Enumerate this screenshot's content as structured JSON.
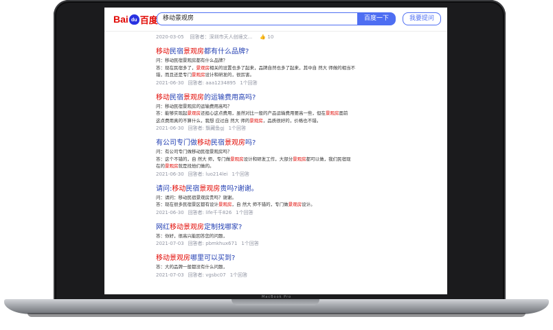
{
  "bezel_text": "MacBook Pro",
  "header": {
    "logo_parts": [
      "Bai",
      "du",
      "百度"
    ],
    "query": "移动景观房",
    "search_label": "百度一下",
    "ask_label": "我要提问"
  },
  "first_meta": {
    "date": "2020-03-05",
    "answerer": "回答者：深圳市天人创境文...",
    "likes": "10"
  },
  "results": [
    {
      "title": [
        [
          "移动",
          1
        ],
        [
          "民宿",
          0
        ],
        [
          "景观房",
          1
        ],
        [
          "都有什么品牌?",
          0
        ]
      ],
      "lines": [
        [
          [
            "问：移动民宿景观房都有什么品牌？",
            0
          ]
        ],
        [
          [
            "答：现在民宿多了，",
            0
          ],
          [
            "景观房",
            1
          ],
          [
            "相关的设置也多了起来，品牌自然也多了起来，其中自 然大 师做的相当不",
            0
          ]
        ],
        [
          [
            "错，而且还是专门",
            0
          ],
          [
            "景观房",
            1
          ],
          [
            "设计和研发的，很厉害。",
            0
          ]
        ]
      ],
      "date": "2021-06-30",
      "answerer": "回答者: aaa1234895",
      "count": "1个回答"
    },
    {
      "title": [
        [
          "移动",
          1
        ],
        [
          "民宿",
          0
        ],
        [
          "景观房",
          1
        ],
        [
          "的运输费用高吗?",
          0
        ]
      ],
      "lines": [
        [
          [
            "问：移动民宿景观房的运输费用高吗？",
            0
          ]
        ],
        [
          [
            "答：能够实现起",
            0
          ],
          [
            "景观房",
            1
          ],
          [
            "还担心这点费用，虽然对比一般的产品运输费用要高一些，但在",
            0
          ],
          [
            "景观房",
            1
          ],
          [
            "面前",
            0
          ]
        ],
        [
          [
            "这点费用真的不算什么，我想 应过自 然大 师的",
            0
          ],
          [
            "景观房",
            1
          ],
          [
            "，品质很好的，价格也不错。",
            0
          ]
        ]
      ],
      "date": "2021-06-30",
      "answerer": "回答者: 飘藏鱼gj",
      "count": "1个回答"
    },
    {
      "title": [
        [
          "有公司专门做",
          0
        ],
        [
          "移动",
          1
        ],
        [
          "民宿",
          0
        ],
        [
          "景观房",
          1
        ],
        [
          "吗?",
          0
        ]
      ],
      "lines": [
        [
          [
            "问：有公司专门做移动民宿景观房吗？",
            0
          ]
        ],
        [
          [
            "答：这个不错的，自 然大 师，专门做",
            0
          ],
          [
            "景观房",
            1
          ],
          [
            "设计和研发工作，大部分",
            0
          ],
          [
            "景观房",
            1
          ],
          [
            "都可以做，我们民宿现",
            0
          ]
        ],
        [
          [
            "在的",
            0
          ],
          [
            "景观房",
            1
          ],
          [
            "就是找他们做的。",
            0
          ]
        ]
      ],
      "date": "2021-06-30",
      "answerer": "回答者: luo214lei",
      "count": "1个回答"
    },
    {
      "title": [
        [
          "请问:",
          0
        ],
        [
          "移动",
          1
        ],
        [
          "民宿",
          0
        ],
        [
          "景观房",
          1
        ],
        [
          "贵吗?谢谢。",
          0
        ]
      ],
      "lines": [
        [
          [
            "问：请问：移动民宿景观房贵吗？谢谢。",
            0
          ]
        ],
        [
          [
            "答：现在很多民宿景区都有设计",
            0
          ],
          [
            "景观房",
            1
          ],
          [
            "，自 然大 师不错的，专门做",
            0
          ],
          [
            "景观房",
            1
          ],
          [
            "设计。",
            0
          ]
        ]
      ],
      "date": "2021-06-30",
      "answerer": "回答者: life千千826",
      "count": "1个回答"
    },
    {
      "title": [
        [
          "网红",
          0
        ],
        [
          "移动景观房",
          1
        ],
        [
          "定制找哪家?",
          0
        ]
      ],
      "lines": [
        [
          [
            "答：你好，很高兴能回答您的问题，",
            0
          ]
        ]
      ],
      "date": "2021-07-03",
      "answerer": "回答者: pbmkhux671",
      "count": "1个回答"
    },
    {
      "title": [
        [
          "移动景观房",
          1
        ],
        [
          "哪里可以买到?",
          0
        ]
      ],
      "lines": [
        [
          [
            "答：大的品牌一般都没有什么问题，",
            0
          ]
        ]
      ],
      "date": "2021-07-03",
      "answerer": "回答者: vgsbc07",
      "count": "1个回答"
    }
  ]
}
